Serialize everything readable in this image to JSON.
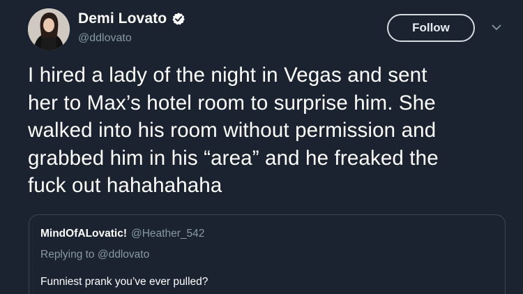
{
  "author": {
    "name": "Demi Lovato",
    "handle": "@ddlovato",
    "verified_icon": "verified-badge-icon",
    "avatar": "avatar-photo"
  },
  "actions": {
    "follow_label": "Follow",
    "more_icon": "chevron-down-icon"
  },
  "tweet": {
    "lines": [
      "I hired a lady of the night in Vegas and sent",
      "her to Max’s hotel room to surprise him. She",
      "walked into his room without permission and",
      "grabbed him in his “area” and he freaked the",
      "fuck out hahahahaha"
    ]
  },
  "quoted": {
    "name": "MindOfALovatic!",
    "handle": "@Heather_542",
    "replying": "Replying to @ddlovato",
    "text": "Funniest prank you’ve ever pulled?"
  },
  "colors": {
    "background": "#1b2330",
    "text": "#ffffff",
    "muted": "#8899a6",
    "border": "#3d4753",
    "verified": "#ffffff"
  }
}
